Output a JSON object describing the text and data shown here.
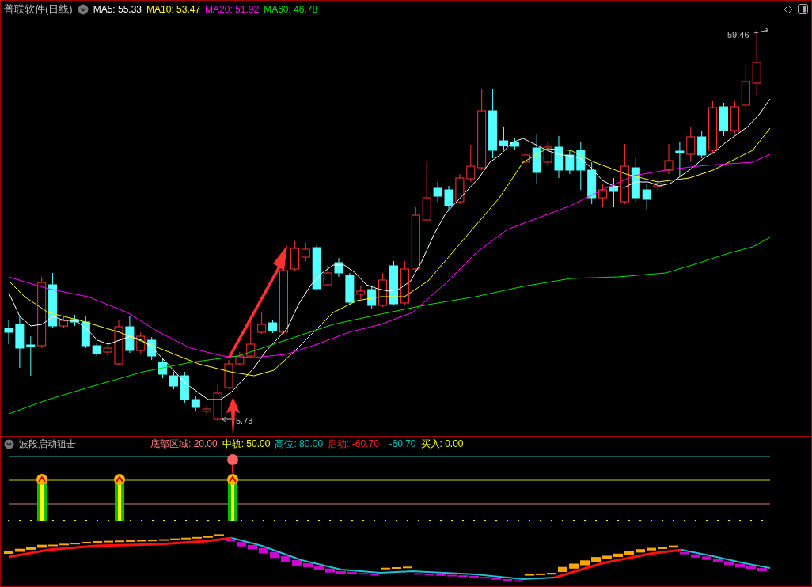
{
  "window": {
    "title": "普联软件(日线)"
  },
  "moving_averages": [
    {
      "label": "MA5: 55.33",
      "color": "#ffffff"
    },
    {
      "label": "MA10: 53.47",
      "color": "#ffff00"
    },
    {
      "label": "MA20: 51.92",
      "color": "#ff00ff"
    },
    {
      "label": "MA60: 46.78",
      "color": "#00e000"
    }
  ],
  "price_chart": {
    "high_label": "59.46",
    "low_label": "5.73"
  },
  "indicator": {
    "title": "波段启动狙击",
    "parameters": [
      {
        "label": "底部区域: 20.00",
        "color": "#ff8080"
      },
      {
        "label": "中轨: 50.00",
        "color": "#ffff00"
      },
      {
        "label": "高位: 80.00",
        "color": "#00c0c0"
      },
      {
        "label": "启动: -60.70",
        "color": "#ff2020"
      },
      {
        "label": ": -60.70",
        "color": "#00c0c0"
      },
      {
        "label": "买入: 0.00",
        "color": "#ffff00"
      }
    ]
  }
}
